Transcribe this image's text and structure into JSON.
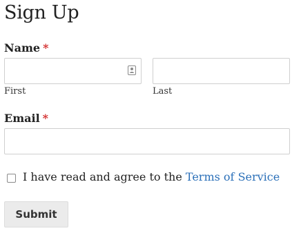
{
  "form": {
    "title": "Sign Up",
    "name": {
      "label": "Name",
      "required_marker": "*",
      "first": {
        "value": "",
        "sublabel": "First"
      },
      "last": {
        "value": "",
        "sublabel": "Last"
      }
    },
    "email": {
      "label": "Email",
      "required_marker": "*",
      "value": ""
    },
    "terms": {
      "checked": false,
      "text": "I have read and agree to the",
      "link_text": "Terms of Service"
    },
    "submit_label": "Submit"
  },
  "colors": {
    "required": "#d32f2f",
    "link": "#2a6fb8",
    "button_bg": "#ebebeb"
  },
  "icons": {
    "first_name_field": "contact-card-icon"
  }
}
